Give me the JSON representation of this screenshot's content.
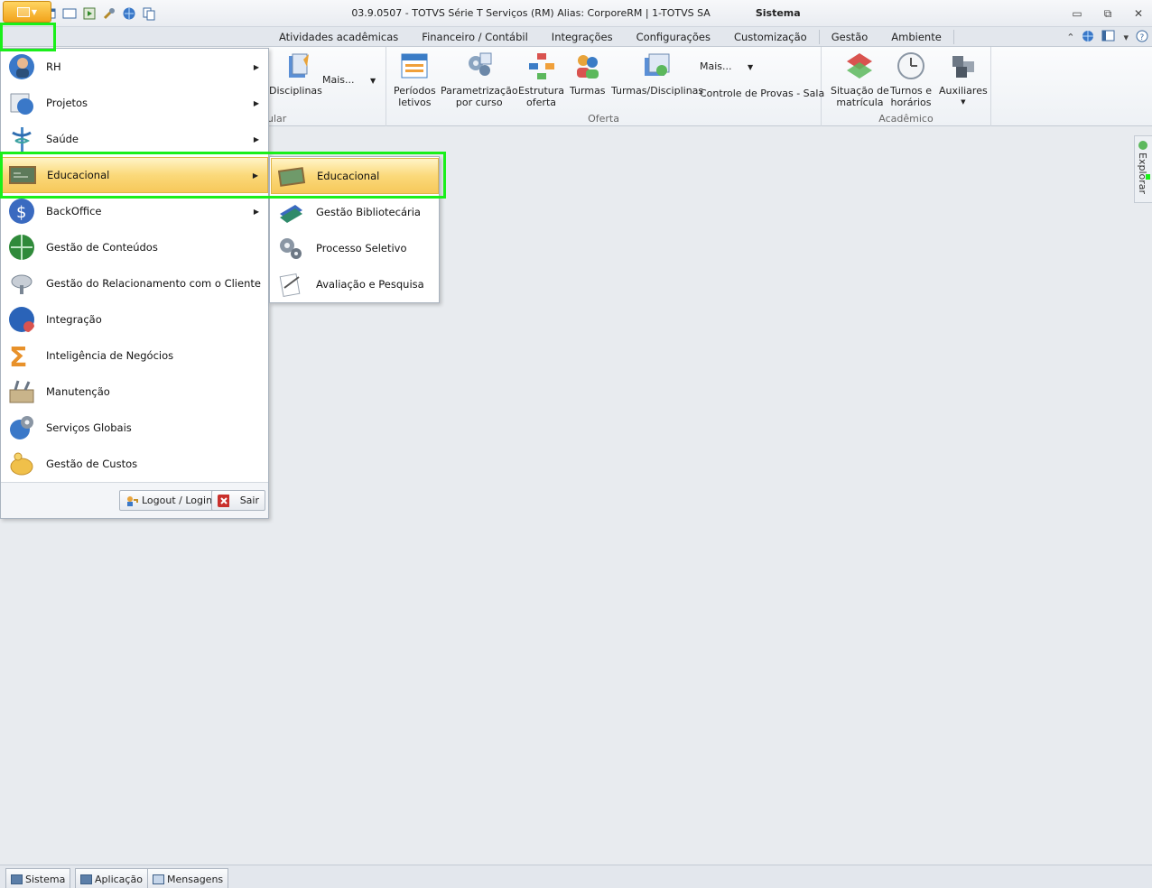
{
  "window": {
    "title": "03.9.0507 - TOTVS Série T Serviços (RM) Alias: CorporeRM | 1-TOTVS SA",
    "context_title": "Sistema",
    "controls": {
      "minimize": "▭",
      "restore": "⧉",
      "close": "✕"
    }
  },
  "ribbon": {
    "tabs": [
      "Atividades acadêmicas",
      "Financeiro / Contábil",
      "Integrações",
      "Configurações",
      "Customização",
      "Gestão",
      "Ambiente"
    ],
    "groups": {
      "curricular": {
        "title": "ular",
        "buttons": [
          "Disciplinas"
        ],
        "more": "Mais..."
      },
      "oferta": {
        "title": "Oferta",
        "buttons": [
          "Períodos\nletivos",
          "Parametrização\npor curso",
          "Estrutura\noferta",
          "Turmas",
          "Turmas/Disciplinas"
        ],
        "more": "Mais...",
        "small": "Controle de Provas - Sala"
      },
      "academico": {
        "title": "Acadêmico",
        "buttons": [
          "Situação de\nmatrícula",
          "Turnos e\nhorários",
          "Auxiliares"
        ]
      }
    },
    "colors": {
      "accent": "#f2a31b",
      "highlight": "#1aef1a"
    }
  },
  "app_menu": {
    "items": [
      {
        "label": "RH",
        "submenu": true
      },
      {
        "label": "Projetos",
        "submenu": true
      },
      {
        "label": "Saúde",
        "submenu": true
      },
      {
        "label": "Educacional",
        "submenu": true,
        "active": true
      },
      {
        "label": "BackOffice",
        "submenu": true
      },
      {
        "label": "Gestão de Conteúdos",
        "submenu": false
      },
      {
        "label": "Gestão do Relacionamento com o Cliente",
        "submenu": false
      },
      {
        "label": "Integração",
        "submenu": false
      },
      {
        "label": "Inteligência de Negócios",
        "submenu": false
      },
      {
        "label": "Manutenção",
        "submenu": false
      },
      {
        "label": "Serviços Globais",
        "submenu": false
      },
      {
        "label": "Gestão de Custos",
        "submenu": false
      }
    ],
    "footer": {
      "logout": "Logout / Login",
      "exit": "Sair"
    }
  },
  "submenu": {
    "items": [
      "Educacional",
      "Gestão Bibliotecária",
      "Processo Seletivo",
      "Avaliação e Pesquisa"
    ]
  },
  "explorer": {
    "label": "Explorar"
  },
  "statusbar": {
    "tabs": [
      "Sistema",
      "Aplicação",
      "Mensagens"
    ]
  }
}
